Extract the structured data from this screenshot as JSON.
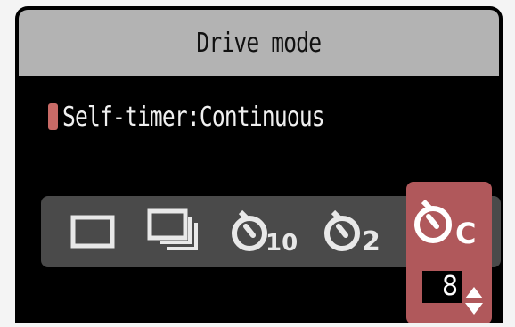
{
  "header": {
    "title": "Drive mode"
  },
  "status": {
    "label": "Self-timer:Continuous"
  },
  "modes": [
    {
      "icon": "single-shot-icon",
      "selected": false
    },
    {
      "icon": "continuous-shooting-icon",
      "selected": false
    },
    {
      "icon": "self-timer-10s-icon",
      "selected": false,
      "badge": "10"
    },
    {
      "icon": "self-timer-2s-icon",
      "selected": false,
      "badge": "2"
    },
    {
      "icon": "self-timer-continuous-icon",
      "selected": true,
      "badge": "C"
    }
  ],
  "shot_count": {
    "value": "8"
  },
  "colors": {
    "accent": "#b0585b",
    "marker": "#c86a66",
    "title_bar": "#b3b3b3",
    "strip": "#4a4a4a"
  }
}
